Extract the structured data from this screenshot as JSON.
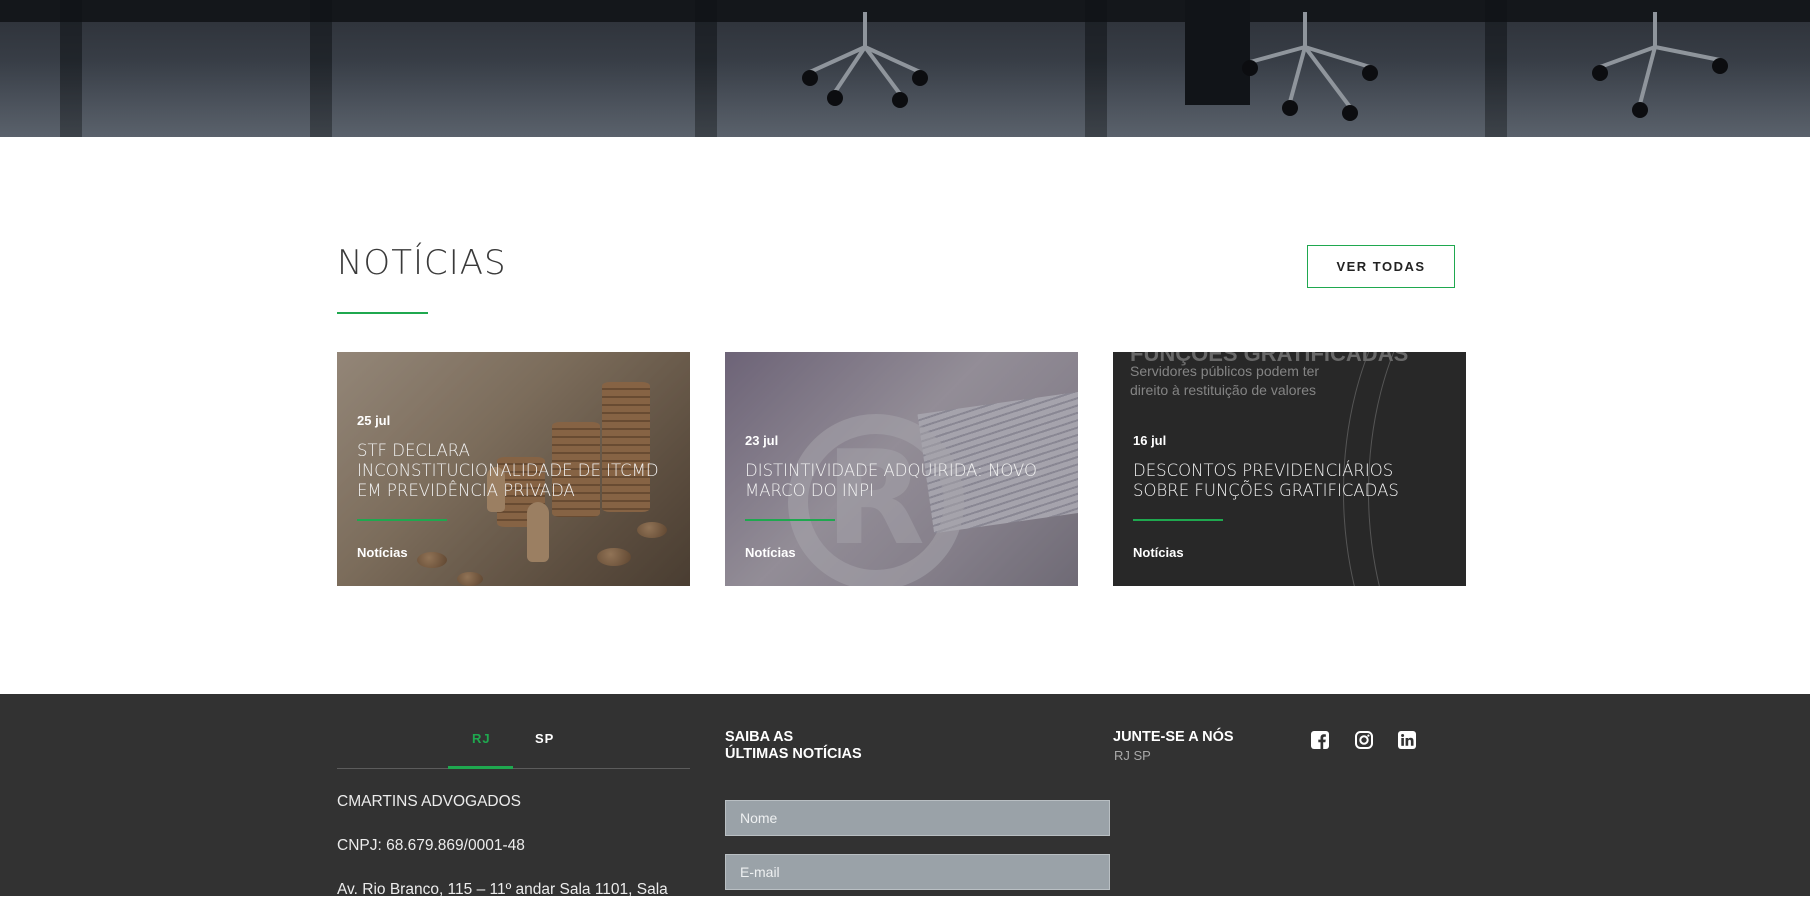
{
  "news": {
    "title": "NOTÍCIAS",
    "view_all_label": "VER TODAS",
    "cards": [
      {
        "date": "25 jul",
        "title": "STF DECLARA INCONSTITUCIONALIDADE DE ITCMD EM PREVIDÊNCIA PRIVADA",
        "category": "Notícias"
      },
      {
        "date": "23 jul",
        "title": "DISTINTIVIDADE ADQUIRIDA: NOVO MARCO DO INPI",
        "category": "Notícias"
      },
      {
        "date": "16 jul",
        "title": "DESCONTOS PREVIDENCIÁRIOS SOBRE FUNÇÕES GRATIFICADAS",
        "category": "Notícias",
        "image_heading": "FUNÇÕES GRATIFICADAS",
        "image_subtitle": "Servidores públicos podem ter direito à restituição de valores"
      }
    ]
  },
  "footer": {
    "tabs": [
      "RJ",
      "SP"
    ],
    "active_tab": "RJ",
    "company_name": "CMARTINS ADVOGADOS",
    "cnpj": "CNPJ: 68.679.869/0001-48",
    "address": "Av. Rio Branco, 115 – 11º andar Sala 1101, Sala",
    "subscribe": {
      "title_line1": "SAIBA AS",
      "title_line2": "ÚLTIMAS NOTÍCIAS",
      "name_placeholder": "Nome",
      "email_placeholder": "E-mail"
    },
    "join": {
      "title": "JUNTE-SE A NÓS",
      "subtitle": "RJ SP"
    },
    "social_icons": [
      "facebook-icon",
      "instagram-icon",
      "linkedin-icon"
    ]
  },
  "colors": {
    "accent": "#1fa84f",
    "footer_bg": "#323232",
    "input_bg": "#9aa2a8"
  }
}
